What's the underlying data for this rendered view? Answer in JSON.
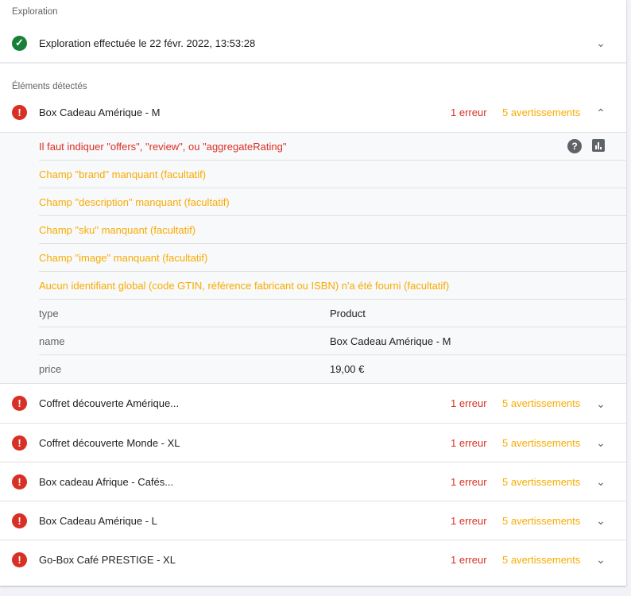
{
  "exploration": {
    "label": "Exploration",
    "status": "Exploration effectuée le 22 févr. 2022, 13:53:28"
  },
  "detected": {
    "label": "Éléments détectés"
  },
  "expanded": {
    "title": "Box Cadeau Amérique - M",
    "errors": "1 erreur",
    "warnings": "5 avertissements",
    "issues": [
      {
        "text": "Il faut indiquer \"offers\", \"review\", ou \"aggregateRating\"",
        "level": "error"
      },
      {
        "text": "Champ \"brand\" manquant (facultatif)",
        "level": "warning"
      },
      {
        "text": "Champ \"description\" manquant (facultatif)",
        "level": "warning"
      },
      {
        "text": "Champ \"sku\" manquant (facultatif)",
        "level": "warning"
      },
      {
        "text": "Champ \"image\" manquant (facultatif)",
        "level": "warning"
      },
      {
        "text": "Aucun identifiant global (code GTIN, référence fabricant ou ISBN) n'a été fourni (facultatif)",
        "level": "warning"
      }
    ],
    "properties": [
      {
        "key": "type",
        "value": "Product"
      },
      {
        "key": "name",
        "value": "Box Cadeau Amérique - M"
      },
      {
        "key": "price",
        "value": "19,00 €"
      }
    ]
  },
  "items": [
    {
      "title": "Coffret découverte Amérique...",
      "errors": "1 erreur",
      "warnings": "5 avertissements"
    },
    {
      "title": "Coffret découverte Monde - XL",
      "errors": "1 erreur",
      "warnings": "5 avertissements"
    },
    {
      "title": "Box cadeau Afrique - Cafés...",
      "errors": "1 erreur",
      "warnings": "5 avertissements"
    },
    {
      "title": "Box Cadeau Amérique - L",
      "errors": "1 erreur",
      "warnings": "5 avertissements"
    },
    {
      "title": "Go-Box Café PRESTIGE - XL",
      "errors": "1 erreur",
      "warnings": "5 avertissements"
    }
  ],
  "colors": {
    "error": "#d93025",
    "warning": "#f9ab00",
    "ok": "#188038"
  }
}
